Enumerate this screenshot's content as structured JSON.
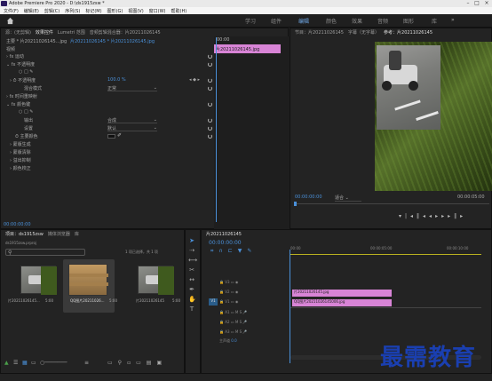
{
  "title_bar": {
    "title": "Adobe Premiere Pro 2020 - D:\\ds1915zsw *"
  },
  "menu": [
    "文件(F)",
    "编辑(E)",
    "剪辑(C)",
    "序列(S)",
    "标记(M)",
    "图形(G)",
    "视图(V)",
    "窗口(W)",
    "帮助(H)"
  ],
  "workspaces": [
    "学习",
    "组件",
    "编辑",
    "颜色",
    "效果",
    "音频",
    "图形",
    "库"
  ],
  "source_panel": {
    "tabs": [
      "源：(无剪辑)",
      "效果控件",
      "Lumetri 范围",
      "音频剪辑混合器：片20211026145"
    ],
    "master": "主要 * 片20211026145...jpg",
    "seq": "片20211026145 * 片20211026145.jpg",
    "mini_time": "00:00",
    "clip_label": "片20211026145.jpg",
    "section_video": "视频",
    "fx_motion": "运动",
    "fx_opacity": "不透明度",
    "opacity_label": "不透明度",
    "opacity_value": "100.0 %",
    "blend_label": "混合模式",
    "blend_value": "正常",
    "time_remap": "时间重映射",
    "fx_key": "颜色键",
    "output_label": "输出",
    "output_value": "合成",
    "setting_label": "设置",
    "setting_value": "默认",
    "key_color_label": "主要颜色",
    "collapsed": [
      "蒙版生成",
      "蒙版清除",
      "溢出抑制",
      "颜色校正"
    ],
    "bottom_time": "00:00:00:00"
  },
  "program_panel": {
    "tabs": [
      "节目：片20211026145",
      "字幕（无字幕）",
      "参考：片20211026145"
    ],
    "timecode": "00:00:00:00",
    "fit": "适合",
    "duration": "00:00:05:00"
  },
  "project_panel": {
    "tabs": [
      "项目：ds1915zsw",
      "媒体浏览器",
      "库"
    ],
    "project_file": "ds1915zsw.prproj",
    "selection_info": "1 项已选择，共 1 项",
    "items": [
      {
        "name": "片20211026145...",
        "duration": "5:00"
      },
      {
        "name": "QQ图片20211026...",
        "duration": "5:00"
      },
      {
        "name": "片20211026145",
        "duration": "5:00"
      }
    ]
  },
  "timeline": {
    "tab": "片20211026145",
    "timecode": "00:00:00:00",
    "ruler": [
      "00:00",
      "00:00:05:00",
      "00:00:10:00"
    ],
    "tracks": [
      {
        "name": "V3"
      },
      {
        "name": "V2"
      },
      {
        "name": "V1"
      },
      {
        "name": "A1"
      },
      {
        "name": "A2"
      },
      {
        "name": "A3"
      },
      {
        "name": "主声道"
      }
    ],
    "master_value": "0.0",
    "clips": [
      {
        "track": "V2",
        "label": "片20211026145.jpg"
      },
      {
        "track": "V1",
        "label": "QQ图片20211026145006.jpg"
      }
    ]
  },
  "watermark": "最需教育",
  "colors": {
    "accent": "#6fa7e6",
    "clip": "#d884d6",
    "playhead": "#4a90d9"
  }
}
